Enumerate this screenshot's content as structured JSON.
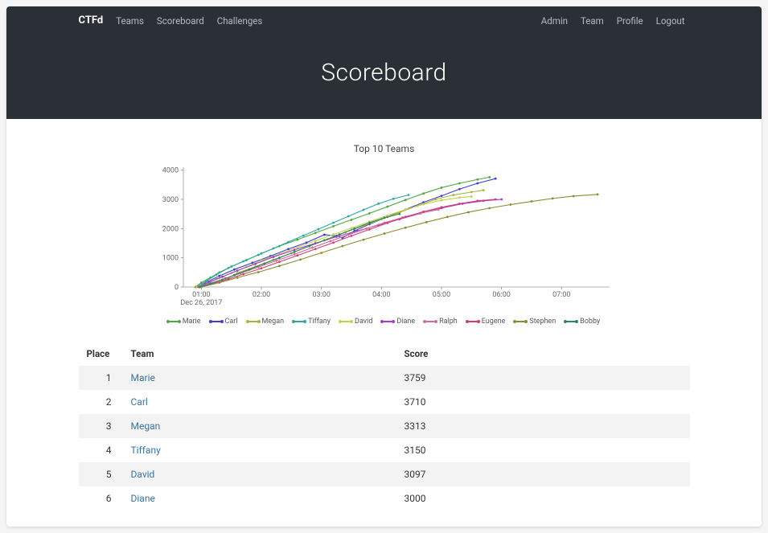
{
  "brand": "CTFd",
  "nav_left": [
    "Teams",
    "Scoreboard",
    "Challenges"
  ],
  "nav_right": [
    "Admin",
    "Team",
    "Profile",
    "Logout"
  ],
  "page_title": "Scoreboard",
  "chart_title": "Top 10 Teams",
  "date_label": "Dec 26, 2017",
  "table": {
    "headers": {
      "place": "Place",
      "team": "Team",
      "score": "Score"
    },
    "rows": [
      {
        "place": 1,
        "team": "Marie",
        "score": 3759
      },
      {
        "place": 2,
        "team": "Carl",
        "score": 3710
      },
      {
        "place": 3,
        "team": "Megan",
        "score": 3313
      },
      {
        "place": 4,
        "team": "Tiffany",
        "score": 3150
      },
      {
        "place": 5,
        "team": "David",
        "score": 3097
      },
      {
        "place": 6,
        "team": "Diane",
        "score": 3000
      }
    ]
  },
  "chart_data": {
    "type": "line",
    "title": "Top 10 Teams",
    "xlabel": "",
    "ylabel": "",
    "x_ticks": [
      "01:00",
      "02:00",
      "03:00",
      "04:00",
      "05:00",
      "06:00",
      "07:00"
    ],
    "y_ticks": [
      0,
      1000,
      2000,
      3000,
      4000
    ],
    "xlim": [
      0.7,
      7.8
    ],
    "ylim": [
      0,
      4100
    ],
    "series": [
      {
        "name": "Marie",
        "color": "#4fa83d",
        "x": [
          0.9,
          1.0,
          1.15,
          1.3,
          1.5,
          1.75,
          2.0,
          2.3,
          2.6,
          2.9,
          3.2,
          3.5,
          3.8,
          4.1,
          4.4,
          4.7,
          5.0,
          5.3,
          5.6,
          5.8
        ],
        "y": [
          0,
          150,
          320,
          500,
          700,
          920,
          1150,
          1400,
          1620,
          1850,
          2080,
          2300,
          2520,
          2750,
          2980,
          3200,
          3400,
          3550,
          3680,
          3759
        ]
      },
      {
        "name": "Carl",
        "color": "#3b3fd6",
        "x": [
          0.95,
          1.1,
          1.3,
          1.55,
          1.85,
          2.15,
          2.45,
          2.75,
          3.05,
          3.25,
          3.35,
          3.55,
          3.8,
          4.1,
          4.4,
          4.7,
          5.0,
          5.3,
          5.6,
          5.9
        ],
        "y": [
          0,
          180,
          380,
          600,
          830,
          1060,
          1300,
          1520,
          1790,
          1750,
          1680,
          1920,
          2150,
          2400,
          2650,
          2900,
          3120,
          3350,
          3550,
          3710
        ]
      },
      {
        "name": "Megan",
        "color": "#a7b534",
        "x": [
          0.9,
          1.1,
          1.25,
          1.35,
          1.45,
          1.6,
          1.9,
          2.2,
          2.5,
          2.8,
          3.1,
          3.4,
          3.7,
          4.0,
          4.3,
          4.6,
          4.9,
          5.2,
          5.5,
          5.7
        ],
        "y": [
          0,
          100,
          280,
          350,
          300,
          480,
          700,
          930,
          1160,
          1400,
          1630,
          1870,
          2100,
          2320,
          2550,
          2780,
          3000,
          3150,
          3250,
          3313
        ]
      },
      {
        "name": "Tiffany",
        "color": "#2aa8a8",
        "x": [
          0.92,
          1.08,
          1.25,
          1.45,
          1.7,
          1.95,
          2.2,
          2.45,
          2.7,
          2.95,
          3.2,
          3.45,
          3.7,
          3.95,
          4.2,
          4.45
        ],
        "y": [
          0,
          200,
          420,
          650,
          880,
          1100,
          1320,
          1540,
          1760,
          1980,
          2200,
          2420,
          2640,
          2850,
          3020,
          3150
        ]
      },
      {
        "name": "David",
        "color": "#c6d24a",
        "x": [
          0.93,
          1.1,
          1.3,
          1.5,
          1.75,
          2.0,
          2.3,
          2.6,
          2.9,
          3.2,
          3.5,
          3.8,
          4.1,
          4.4,
          4.7,
          5.0,
          5.3,
          5.5
        ],
        "y": [
          0,
          140,
          300,
          480,
          690,
          910,
          1130,
          1360,
          1580,
          1800,
          2020,
          2240,
          2450,
          2650,
          2830,
          2970,
          3060,
          3097
        ]
      },
      {
        "name": "Diane",
        "color": "#a23bd2",
        "x": [
          0.95,
          1.12,
          1.35,
          1.6,
          1.9,
          2.2,
          2.55,
          2.9,
          3.25,
          3.6,
          3.95,
          4.3,
          4.65,
          5.0,
          5.35,
          5.7,
          6.0
        ],
        "y": [
          0,
          160,
          350,
          560,
          790,
          1030,
          1270,
          1500,
          1720,
          1920,
          2120,
          2320,
          2520,
          2700,
          2850,
          2950,
          3000
        ]
      },
      {
        "name": "Ralph",
        "color": "#d46ba0",
        "x": [
          0.96,
          1.15,
          1.4,
          1.65,
          1.95,
          2.25,
          2.55,
          2.85,
          3.15,
          3.45,
          3.75,
          4.05,
          4.35,
          4.65,
          4.95
        ],
        "y": [
          0,
          130,
          290,
          470,
          680,
          900,
          1120,
          1350,
          1570,
          1790,
          2000,
          2200,
          2380,
          2530,
          2650
        ]
      },
      {
        "name": "Eugene",
        "color": "#d63b6d",
        "x": [
          0.98,
          1.2,
          1.45,
          1.7,
          2.0,
          2.3,
          2.6,
          2.9,
          3.2,
          3.5,
          3.8,
          4.1,
          4.4,
          4.7,
          5.0,
          5.3,
          5.6,
          5.9
        ],
        "y": [
          0,
          120,
          270,
          440,
          640,
          860,
          1080,
          1300,
          1520,
          1750,
          1970,
          2190,
          2400,
          2580,
          2730,
          2850,
          2950,
          3000
        ]
      },
      {
        "name": "Stephen",
        "color": "#8a8d2f",
        "x": [
          1.0,
          1.3,
          1.6,
          1.95,
          2.3,
          2.65,
          3.0,
          3.35,
          3.7,
          4.05,
          4.4,
          4.75,
          5.1,
          5.45,
          5.8,
          6.15,
          6.5,
          6.85,
          7.2,
          7.6
        ],
        "y": [
          0,
          150,
          320,
          510,
          720,
          940,
          1170,
          1400,
          1620,
          1830,
          2030,
          2220,
          2400,
          2560,
          2700,
          2820,
          2930,
          3030,
          3110,
          3170
        ]
      },
      {
        "name": "Bobby",
        "color": "#2d8659",
        "x": [
          0.97,
          1.15,
          1.35,
          1.55,
          1.8,
          2.05,
          2.3,
          2.55,
          2.8,
          3.05,
          3.3,
          3.55,
          3.8,
          4.05,
          4.3
        ],
        "y": [
          0,
          110,
          250,
          410,
          600,
          800,
          1000,
          1200,
          1400,
          1600,
          1800,
          2000,
          2200,
          2370,
          2500
        ]
      }
    ]
  }
}
